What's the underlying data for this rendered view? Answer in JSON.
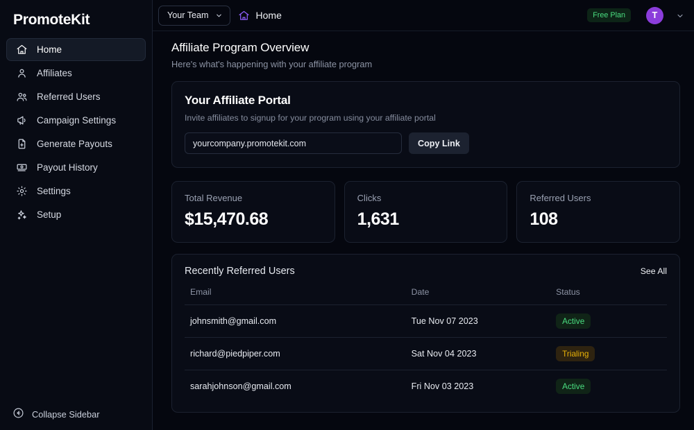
{
  "sidebar": {
    "brand": "PromoteKit",
    "items": [
      {
        "label": "Home",
        "icon": "home-icon",
        "active": true
      },
      {
        "label": "Affiliates",
        "icon": "user-icon",
        "active": false
      },
      {
        "label": "Referred Users",
        "icon": "users-icon",
        "active": false
      },
      {
        "label": "Campaign Settings",
        "icon": "megaphone-icon",
        "active": false
      },
      {
        "label": "Generate Payouts",
        "icon": "file-plus-icon",
        "active": false
      },
      {
        "label": "Payout History",
        "icon": "banknote-icon",
        "active": false
      },
      {
        "label": "Settings",
        "icon": "gear-icon",
        "active": false
      },
      {
        "label": "Setup",
        "icon": "sparkles-icon",
        "active": false
      }
    ],
    "collapse_label": "Collapse Sidebar",
    "collapse_icon": "arrow-left-circle-icon"
  },
  "topbar": {
    "team_label": "Your Team",
    "team_chevron_icon": "chevron-down-icon",
    "breadcrumb_icon": "home-icon",
    "breadcrumb_label": "Home",
    "plan_badge": "Free Plan",
    "avatar_initial": "T",
    "avatar_chevron_icon": "chevron-down-icon"
  },
  "page": {
    "title": "Affiliate Program Overview",
    "subtitle": "Here's what's happening with your affiliate program"
  },
  "portal": {
    "title": "Your Affiliate Portal",
    "subtitle": "Invite affiliates to signup for your program using your affiliate portal",
    "url_value": "yourcompany.promotekit.com",
    "url_placeholder": "yourcompany.promotekit.com",
    "copy_label": "Copy Link"
  },
  "stats": [
    {
      "label": "Total Revenue",
      "value": "$15,470.68"
    },
    {
      "label": "Clicks",
      "value": "1,631"
    },
    {
      "label": "Referred Users",
      "value": "108"
    }
  ],
  "table": {
    "title": "Recently Referred Users",
    "see_all_label": "See All",
    "columns": [
      "Email",
      "Date",
      "Status"
    ],
    "rows": [
      {
        "email": "johnsmith@gmail.com",
        "date": "Tue Nov 07 2023",
        "status": "Active",
        "status_kind": "active"
      },
      {
        "email": "richard@piedpiper.com",
        "date": "Sat Nov 04 2023",
        "status": "Trialing",
        "status_kind": "trialing"
      },
      {
        "email": "sarahjohnson@gmail.com",
        "date": "Fri Nov 03 2023",
        "status": "Active",
        "status_kind": "active"
      }
    ]
  },
  "colors": {
    "background": "#05070f",
    "card": "#090c16",
    "border": "#1c2230",
    "accent_purple": "#8b5cf6",
    "avatar_purple": "#8b3ddb",
    "status_active": "#4ade80",
    "status_trialing": "#eab308"
  }
}
